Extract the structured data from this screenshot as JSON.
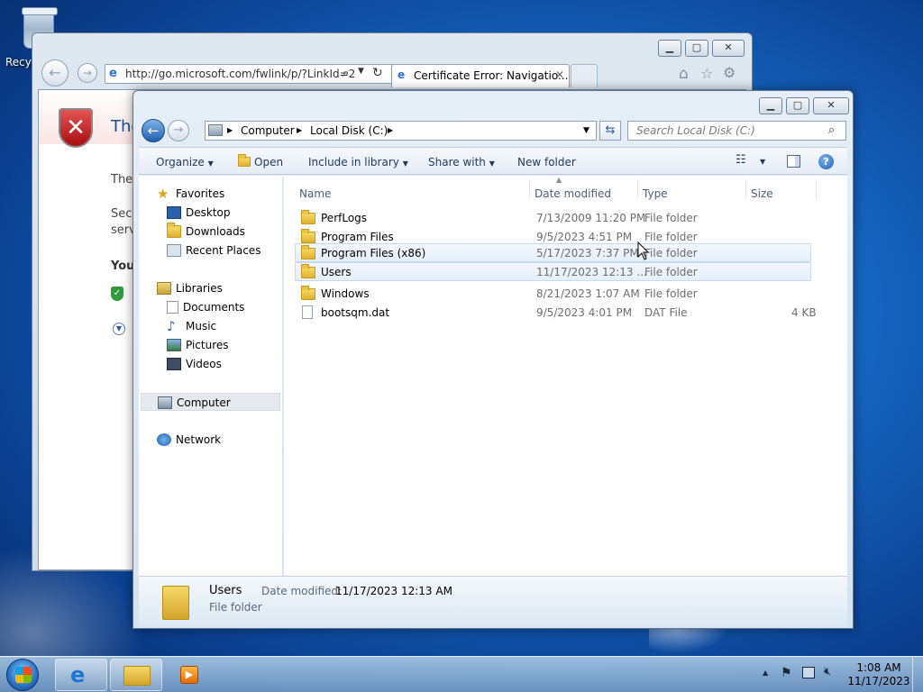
{
  "desktop": {
    "recycle_bin_label": "Recy"
  },
  "ie": {
    "address": "http://go.microsoft.com/fwlink/p/?LinkId=2",
    "tab_title": "Certificate Error: Navigatio...",
    "content_heading": "The",
    "content_line1": "The",
    "content_line2a": "Secu",
    "content_line2b": "serv",
    "content_bold": "You",
    "icons": [
      "back-icon",
      "forward-icon",
      "search-icon",
      "refresh-icon",
      "home-icon",
      "favorites-star-icon",
      "gear-icon",
      "shield-error-icon"
    ]
  },
  "explorer": {
    "breadcrumb": [
      "Computer",
      "Local Disk (C:)"
    ],
    "search_placeholder": "Search Local Disk (C:)",
    "toolbar": {
      "organize": "Organize",
      "open": "Open",
      "include_in_library": "Include in library",
      "share_with": "Share with",
      "new_folder": "New folder"
    },
    "nav": {
      "favorites": "Favorites",
      "desktop": "Desktop",
      "downloads": "Downloads",
      "recent_places": "Recent Places",
      "libraries": "Libraries",
      "documents": "Documents",
      "music": "Music",
      "pictures": "Pictures",
      "videos": "Videos",
      "computer": "Computer",
      "network": "Network"
    },
    "columns": {
      "name": "Name",
      "date": "Date modified",
      "type": "Type",
      "size": "Size"
    },
    "files": [
      {
        "name": "PerfLogs",
        "date": "7/13/2009 11:20 PM",
        "type": "File folder",
        "size": ""
      },
      {
        "name": "Program Files",
        "date": "9/5/2023 4:51 PM",
        "type": "File folder",
        "size": ""
      },
      {
        "name": "Program Files (x86)",
        "date": "5/17/2023 7:37 PM",
        "type": "File folder",
        "size": ""
      },
      {
        "name": "Users",
        "date": "11/17/2023 12:13 ...",
        "type": "File folder",
        "size": ""
      },
      {
        "name": "Windows",
        "date": "8/21/2023 1:07 AM",
        "type": "File folder",
        "size": ""
      },
      {
        "name": "bootsqm.dat",
        "date": "9/5/2023 4:01 PM",
        "type": "DAT File",
        "size": "4 KB"
      }
    ],
    "details": {
      "name": "Users",
      "type": "File folder",
      "date_label": "Date modified:",
      "date_value": "11/17/2023 12:13 AM"
    }
  },
  "taskbar": {
    "time": "1:08 AM",
    "date": "11/17/2023"
  }
}
